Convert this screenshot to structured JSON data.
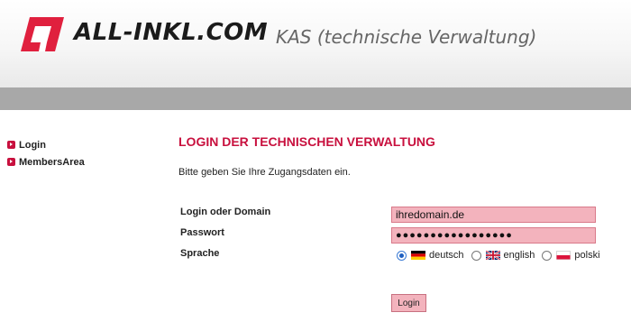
{
  "header": {
    "logo_text": "ALL-INKL.COM",
    "app_title": "KAS (technische Verwaltung)"
  },
  "sidebar": {
    "items": [
      {
        "label": "Login"
      },
      {
        "label": "MembersArea"
      }
    ]
  },
  "main": {
    "heading": "LOGIN DER TECHNISCHEN VERWALTUNG",
    "intro": "Bitte geben Sie Ihre Zugangsdaten ein.",
    "form": {
      "login_label": "Login oder Domain",
      "login_value": "ihredomain.de",
      "password_label": "Passwort",
      "password_value": "●●●●●●●●●●●●●●●●●",
      "language_label": "Sprache",
      "languages": [
        {
          "label": "deutsch",
          "selected": true,
          "flag": "de-flag"
        },
        {
          "label": "english",
          "selected": false,
          "flag": "uk-flag"
        },
        {
          "label": "polski",
          "selected": false,
          "flag": "pl-flag"
        }
      ],
      "submit_label": "Login"
    }
  },
  "colors": {
    "accent": "#c8103e",
    "field_bg": "#f3b3bd",
    "bar": "#a8a8a8"
  }
}
